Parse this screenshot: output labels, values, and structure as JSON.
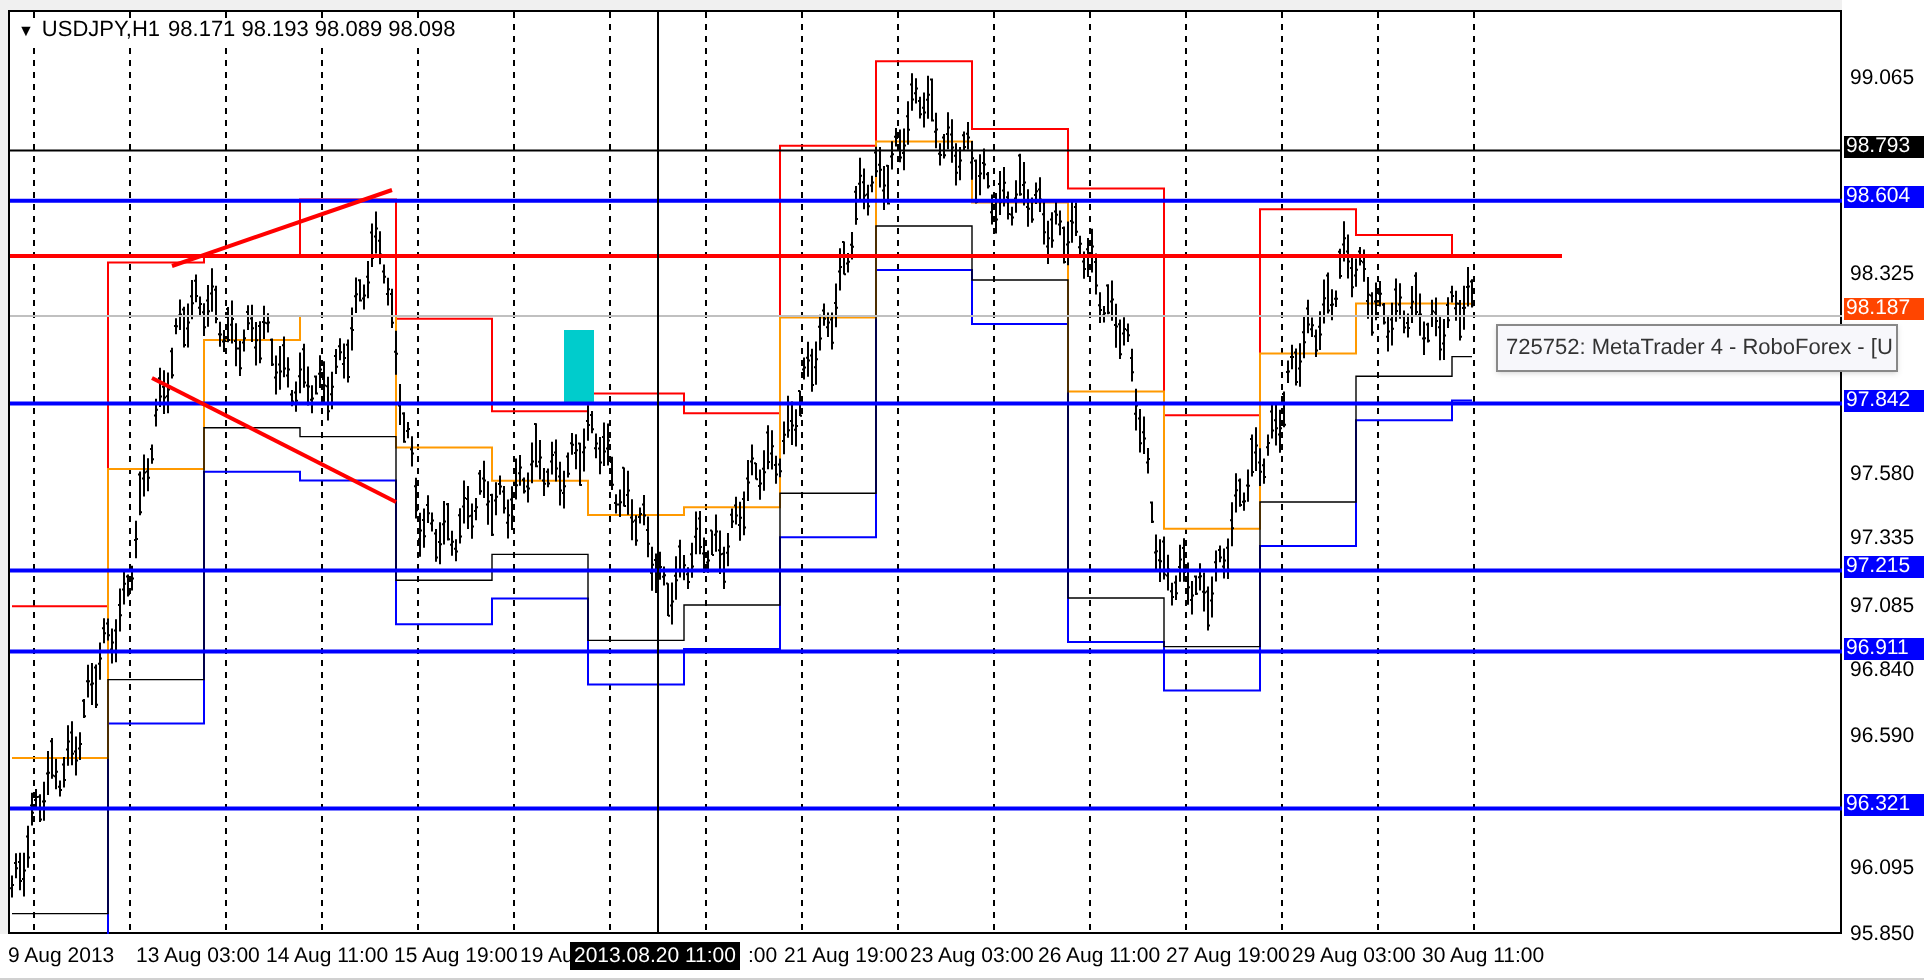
{
  "chart": {
    "symbol": "USDJPY,H1",
    "ohlc": "98.171 98.193 98.089 98.098",
    "menu_glyph": "▼"
  },
  "price_scale": [
    "99.065",
    "98.325",
    "97.580",
    "97.335",
    "97.085",
    "96.840",
    "96.590",
    "96.095",
    "95.850"
  ],
  "price_tags": [
    {
      "text": "98.793",
      "kind": "crosshair"
    },
    {
      "text": "98.604",
      "kind": "level"
    },
    {
      "text": "98.187",
      "kind": "bid"
    },
    {
      "text": "97.842",
      "kind": "level"
    },
    {
      "text": "97.215",
      "kind": "level"
    },
    {
      "text": "96.911",
      "kind": "level"
    },
    {
      "text": "96.321",
      "kind": "level"
    }
  ],
  "time_axis": [
    {
      "text": "9 Aug 2013",
      "kind": "date"
    },
    {
      "text": "13 Aug 03:00",
      "kind": "date"
    },
    {
      "text": "14 Aug 11:00",
      "kind": "date"
    },
    {
      "text": "15 Aug 19:00",
      "kind": "date"
    },
    {
      "text": "19 Au",
      "kind": "date"
    },
    {
      "text": "2013.08.20 11:00",
      "kind": "crosshair"
    },
    {
      "text": ":00",
      "kind": "date"
    },
    {
      "text": "21 Aug 19:00",
      "kind": "date"
    },
    {
      "text": "23 Aug 03:00",
      "kind": "date"
    },
    {
      "text": "26 Aug 11:00",
      "kind": "date"
    },
    {
      "text": "27 Aug 19:00",
      "kind": "date"
    },
    {
      "text": "29 Aug 03:00",
      "kind": "date"
    },
    {
      "text": "30 Aug 11:00",
      "kind": "date"
    }
  ],
  "tooltip": "725752: MetaTrader 4 - RoboForex - [U"
}
